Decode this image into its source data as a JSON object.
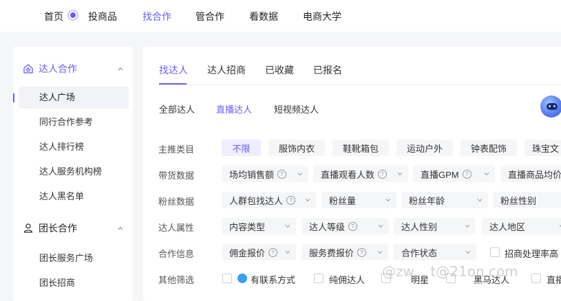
{
  "nav": {
    "items": [
      "首页",
      "投商品",
      "找合作",
      "管合作",
      "看数据",
      "电商大学"
    ],
    "active_index": 2
  },
  "sidebar": {
    "group1": {
      "title": "达人合作",
      "icon": "star-house-icon"
    },
    "items": [
      "达人广场",
      "同行合作参考",
      "达人排行榜",
      "达人服务机构榜",
      "达人黑名单"
    ],
    "active_index": 0,
    "group2": {
      "title": "团长合作",
      "icon": "group-icon"
    },
    "items2": [
      "团长服务广场",
      "团长招商"
    ]
  },
  "tabs": [
    "找达人",
    "达人招商",
    "已收藏",
    "已报名"
  ],
  "active_tab": 0,
  "subtabs": [
    "全部达人",
    "直播达人",
    "短视频达人"
  ],
  "active_subtab": 1,
  "filters": {
    "category": {
      "label": "主推类目",
      "options": [
        "不限",
        "服饰内衣",
        "鞋靴箱包",
        "运动户外",
        "钟表配饰",
        "珠宝文"
      ]
    },
    "sales": {
      "label": "带货数据",
      "options": [
        "场均销售额",
        "直播观看人数",
        "直播GPM",
        "直播商品均价"
      ]
    },
    "fans": {
      "label": "粉丝数据",
      "options": [
        "人群包找达人",
        "粉丝量",
        "粉丝年龄",
        "粉丝性别"
      ]
    },
    "attr": {
      "label": "达人属性",
      "options": [
        "内容类型",
        "达人等级",
        "达人性别",
        "达人地区"
      ]
    },
    "coop": {
      "label": "合作信息",
      "options": [
        "佣金报价",
        "服务费报价",
        "合作状态"
      ],
      "checkbox": "招商处理率高"
    },
    "other": {
      "label": "其他筛选",
      "options": [
        "有联系方式",
        "纯佣达人",
        "明星",
        "黑马达人",
        "直播"
      ]
    }
  },
  "watermark": "@zw... t@21on.com",
  "colors": {
    "accent": "#6a5cf4",
    "chip_bg": "#f5f6f8",
    "page_bg": "#f5f6f8"
  }
}
